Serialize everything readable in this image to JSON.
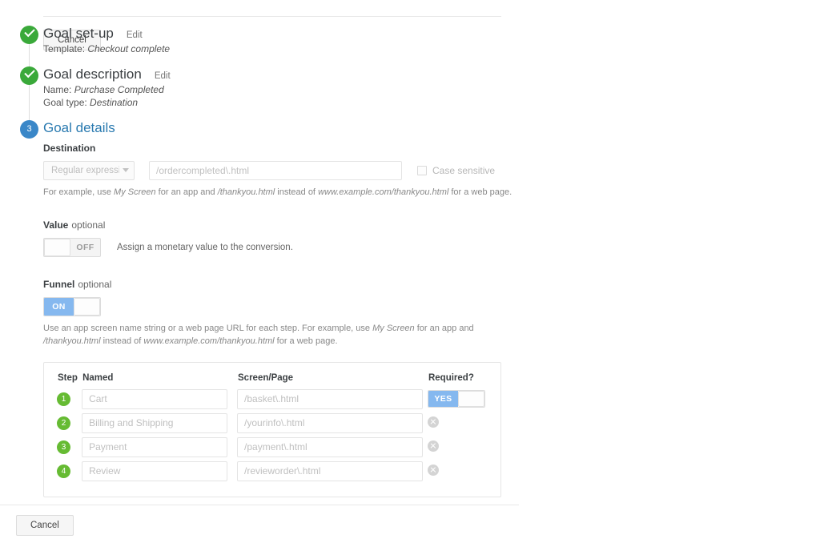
{
  "wizard": {
    "steps": [
      {
        "number": "1",
        "state": "done",
        "title": "Goal set-up",
        "edit_label": "Edit",
        "summary": [
          {
            "label": "Template:",
            "value": "Checkout complete"
          }
        ]
      },
      {
        "number": "2",
        "state": "done",
        "title": "Goal description",
        "edit_label": "Edit",
        "summary": [
          {
            "label": "Name:",
            "value": "Purchase Completed"
          },
          {
            "label": "Goal type:",
            "value": "Destination"
          }
        ]
      },
      {
        "number": "3",
        "state": "active",
        "title": "Goal details"
      }
    ]
  },
  "details": {
    "destination": {
      "label": "Destination",
      "match_type_value": "Regular expression",
      "input_value": "/ordercompleted\\.html",
      "input_placeholder": "/ordercompleted\\.html",
      "case_sensitive_label": "Case sensitive",
      "case_sensitive_checked": false,
      "helper_parts": [
        {
          "text": "For example, use ",
          "italic": false
        },
        {
          "text": "My Screen",
          "italic": true
        },
        {
          "text": " for an app and ",
          "italic": false
        },
        {
          "text": "/thankyou.html",
          "italic": true
        },
        {
          "text": " instead of ",
          "italic": false
        },
        {
          "text": "www.example.com/thankyou.html",
          "italic": true
        },
        {
          "text": " for a web page.",
          "italic": false
        }
      ]
    },
    "value": {
      "label": "Value",
      "optional_label": "optional",
      "toggle_state": "OFF",
      "description": "Assign a monetary value to the conversion."
    },
    "funnel": {
      "label": "Funnel",
      "optional_label": "optional",
      "toggle_state": "ON",
      "helper_parts": [
        {
          "text": "Use an app screen name string or a web page URL for each step. For example, use ",
          "italic": false
        },
        {
          "text": "My Screen",
          "italic": true
        },
        {
          "text": " for an app and ",
          "italic": false
        },
        {
          "text": "/thankyou.html",
          "italic": true
        },
        {
          "text": " instead of ",
          "italic": false
        },
        {
          "text": "www.example.com/thankyou.html",
          "italic": true
        },
        {
          "text": " for a web page.",
          "italic": false
        }
      ],
      "columns": [
        "Step",
        "Named",
        "Screen/Page",
        "Required?"
      ],
      "rows": [
        {
          "step": "1",
          "named_value": "Cart",
          "named_placeholder": "Cart",
          "screen_value": "/basket\\.html",
          "screen_placeholder": "/basket\\.html",
          "required_toggle": "YES",
          "has_toggle": true
        },
        {
          "step": "2",
          "named_value": "Billing and Shipping",
          "named_placeholder": "Billing and Shipping",
          "screen_value": "/yourinfo\\.html",
          "screen_placeholder": "/yourinfo\\.html",
          "has_toggle": false
        },
        {
          "step": "3",
          "named_value": "Payment",
          "named_placeholder": "Payment",
          "screen_value": "/payment\\.html",
          "screen_placeholder": "/payment\\.html",
          "has_toggle": false
        },
        {
          "step": "4",
          "named_value": "Review",
          "named_placeholder": "Review",
          "screen_value": "/revieworder\\.html",
          "screen_placeholder": "/revieworder\\.html",
          "has_toggle": false
        }
      ]
    }
  },
  "actions": {
    "inner_cancel_label": "Cancel",
    "footer_cancel_label": "Cancel"
  },
  "colors": {
    "done_green": "#3aa93a",
    "active_blue": "#3a87c8",
    "step_badge_green": "#66bb33",
    "toggle_on_blue": "#85b8ef",
    "title_blue": "#2a7ab0"
  }
}
